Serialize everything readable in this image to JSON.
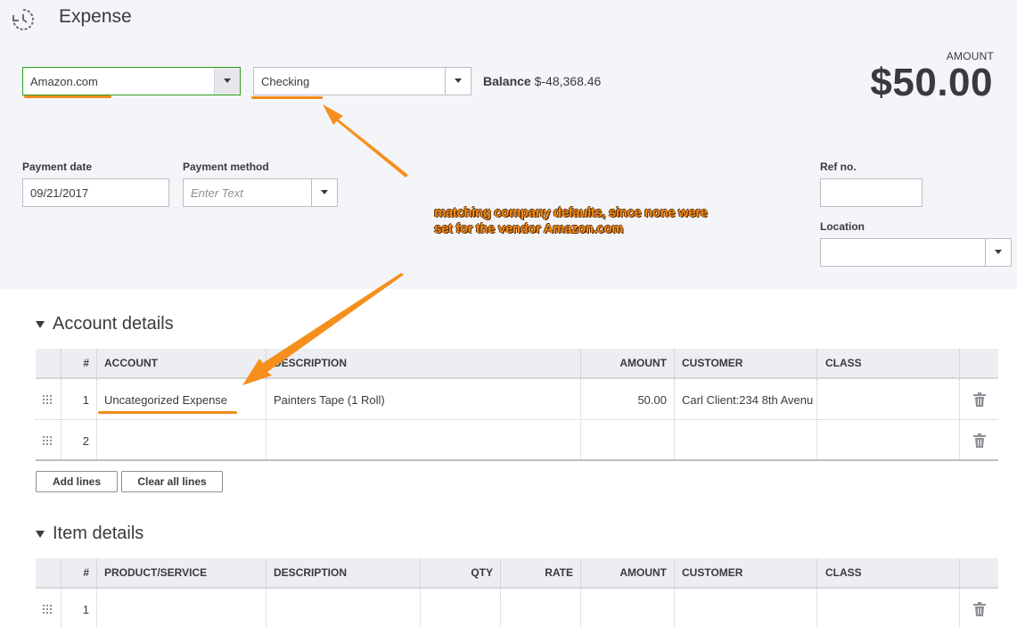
{
  "header": {
    "title": "Expense",
    "icon": "history-icon"
  },
  "payee": {
    "value": "Amazon.com"
  },
  "account": {
    "value": "Checking"
  },
  "balance": {
    "label": "Balance",
    "value": "$-48,368.46"
  },
  "amount": {
    "label": "AMOUNT",
    "value": "$50.00"
  },
  "payment_date": {
    "label": "Payment date",
    "value": "09/21/2017"
  },
  "payment_method": {
    "label": "Payment method",
    "placeholder": "Enter Text"
  },
  "ref_no": {
    "label": "Ref no.",
    "value": ""
  },
  "location": {
    "label": "Location",
    "value": ""
  },
  "annotation": {
    "line1": "matching company defaults, since none were",
    "line2": "set for the vendor Amazon.com",
    "color": "#f28b1a"
  },
  "account_details": {
    "title": "Account details",
    "columns": [
      "#",
      "ACCOUNT",
      "DESCRIPTION",
      "AMOUNT",
      "CUSTOMER",
      "CLASS"
    ],
    "rows": [
      {
        "num": "1",
        "account": "Uncategorized Expense",
        "description": "Painters Tape (1 Roll)",
        "amount": "50.00",
        "customer": "Carl Client:234 8th Avenu",
        "class": ""
      },
      {
        "num": "2",
        "account": "",
        "description": "",
        "amount": "",
        "customer": "",
        "class": ""
      }
    ],
    "add_lines": "Add lines",
    "clear_lines": "Clear all lines"
  },
  "item_details": {
    "title": "Item details",
    "columns": [
      "#",
      "PRODUCT/SERVICE",
      "DESCRIPTION",
      "QTY",
      "RATE",
      "AMOUNT",
      "CUSTOMER",
      "CLASS"
    ],
    "rows": [
      {
        "num": "1"
      }
    ]
  },
  "colors": {
    "accent_green": "#2ca01c",
    "annotation_orange": "#f28b1a",
    "header_bg": "#f4f5f8"
  }
}
